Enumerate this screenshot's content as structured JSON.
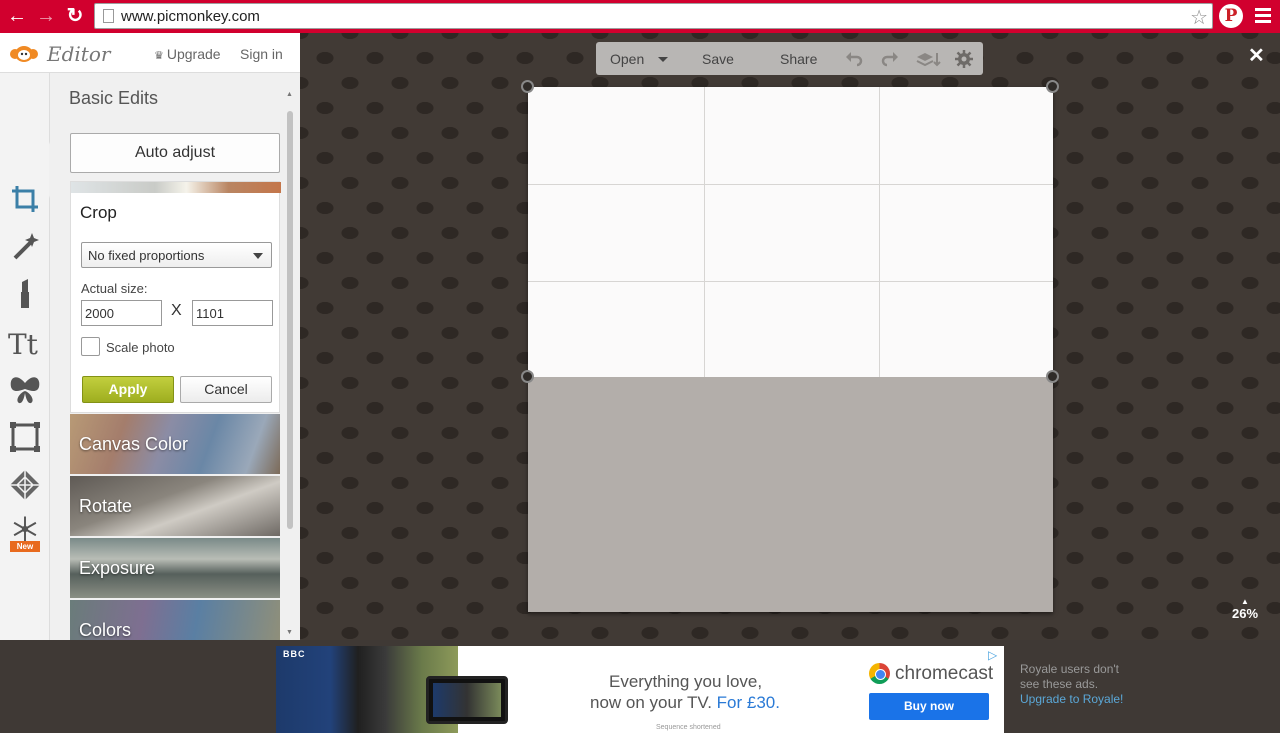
{
  "browser": {
    "url": "www.picmonkey.com",
    "pin_label": "P"
  },
  "app": {
    "logo_text": "Editor",
    "upgrade_label": "Upgrade",
    "signin_label": "Sign in"
  },
  "tool_rail": [
    "crop-icon",
    "magic-wand-icon",
    "lipstick-icon",
    "text-tt-icon",
    "butterfly-icon",
    "frame-icon",
    "texture-icon",
    "snowflake-icon"
  ],
  "tool_rail_new_badge": "New",
  "panel": {
    "title": "Basic Edits",
    "auto_adjust_label": "Auto adjust",
    "crop": {
      "title": "Crop",
      "proportion_selected": "No fixed proportions",
      "actual_size_label": "Actual size:",
      "width_value": "2000",
      "height_value": "1101",
      "separator": "X",
      "scale_label": "Scale photo",
      "scale_checked": false,
      "apply_label": "Apply",
      "cancel_label": "Cancel"
    },
    "tools": [
      "Canvas Color",
      "Rotate",
      "Exposure",
      "Colors"
    ]
  },
  "toolbar": {
    "open_label": "Open",
    "save_label": "Save",
    "share_label": "Share"
  },
  "canvas": {
    "zoom_level": "26%"
  },
  "ad": {
    "brand": "BBC",
    "line1": "Everything you love,",
    "line2_prefix": "now on your TV. ",
    "line2_price": "For £30.",
    "fine_print": "Sequence shortened",
    "product": "chromecast",
    "buy_label": "Buy now"
  },
  "royale": {
    "text": "Royale users don't see these ads.",
    "link": "Upgrade to Royale!"
  },
  "colors": {
    "browser_bar": "#d1002e",
    "apply_green": "#9eae1f",
    "workspace_bg": "#413a35"
  }
}
